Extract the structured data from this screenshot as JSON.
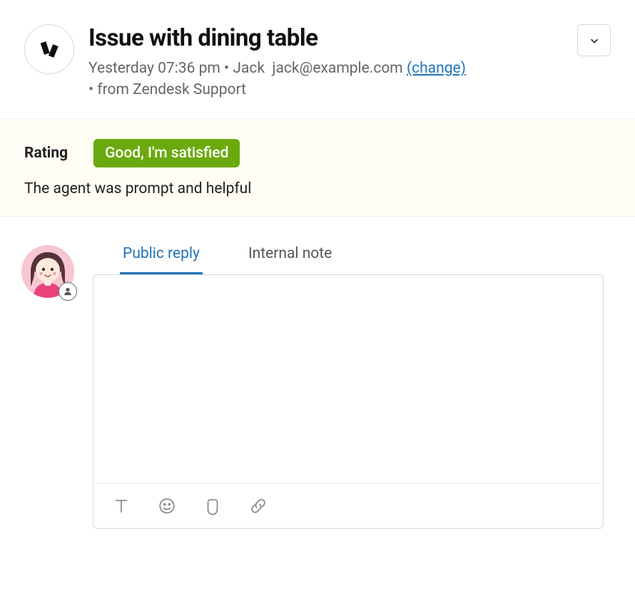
{
  "header": {
    "title": "Issue with dining table",
    "timestamp": "Yesterday 07:36 pm",
    "author": "Jack",
    "email": "jack@example.com",
    "change_label": "(change)",
    "source_prefix": "• from ",
    "source": "Zendesk Support",
    "sep": " • "
  },
  "rating": {
    "label": "Rating",
    "badge": "Good, I'm satisfied",
    "comment": "The agent was prompt and helpful"
  },
  "composer": {
    "tabs": {
      "public": "Public reply",
      "internal": "Internal note"
    },
    "body": ""
  },
  "colors": {
    "link": "#1f73b7",
    "rating_bg": "#fffdf4",
    "rating_badge": "#6aaa0f"
  }
}
